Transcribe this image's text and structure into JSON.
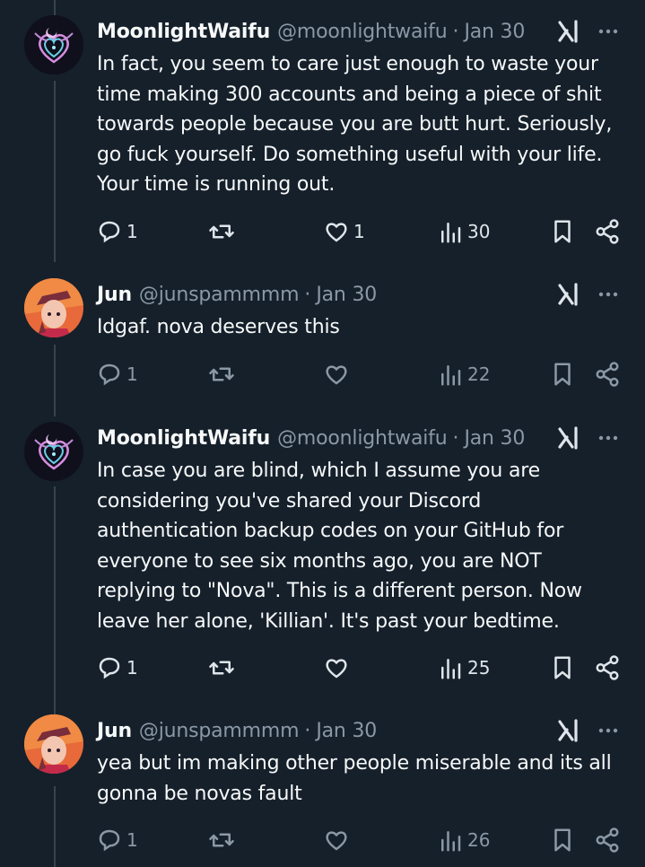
{
  "tweets": [
    {
      "name": "MoonlightWaifu",
      "handle": "@moonlightwaifu",
      "separator": "·",
      "date": "Jan 30",
      "text": "In fact, you seem to care just enough to waste your time making 300 accounts and being a piece of shit towards people because you are butt hurt. Seriously, go fuck yourself. Do something useful with your life. Your time is running out.",
      "replies": "1",
      "retweets": "",
      "likes": "1",
      "views": "30"
    },
    {
      "name": "Jun",
      "handle": "@junspammmm",
      "separator": "·",
      "date": "Jan 30",
      "text": "Idgaf. nova deserves this",
      "replies": "1",
      "retweets": "",
      "likes": "",
      "views": "22"
    },
    {
      "name": "MoonlightWaifu",
      "handle": "@moonlightwaifu",
      "separator": "·",
      "date": "Jan 30",
      "text": "In case you are blind, which I assume you are considering you've shared your Discord authentication backup codes on your GitHub for everyone to see six months ago, you are NOT replying to \"Nova\". This is a different person. Now leave her alone, 'Killian'. It's past your bedtime.",
      "replies": "1",
      "retweets": "",
      "likes": "",
      "views": "25"
    },
    {
      "name": "Jun",
      "handle": "@junspammmm",
      "separator": "·",
      "date": "Jan 30",
      "text": "yea but im making other people miserable and its all gonna be novas fault",
      "replies": "1",
      "retweets": "",
      "likes": "",
      "views": "26"
    }
  ],
  "icons": {
    "reply": "reply-icon",
    "retweet": "retweet-icon",
    "like": "heart-icon",
    "views": "views-icon",
    "bookmark": "bookmark-icon",
    "share": "share-icon",
    "grok": "grok-icon",
    "more": "more-icon"
  },
  "colors": {
    "background": "#15202b",
    "text": "#f7f9f9",
    "secondary": "#8b98a5",
    "thread_line": "#38444d"
  }
}
